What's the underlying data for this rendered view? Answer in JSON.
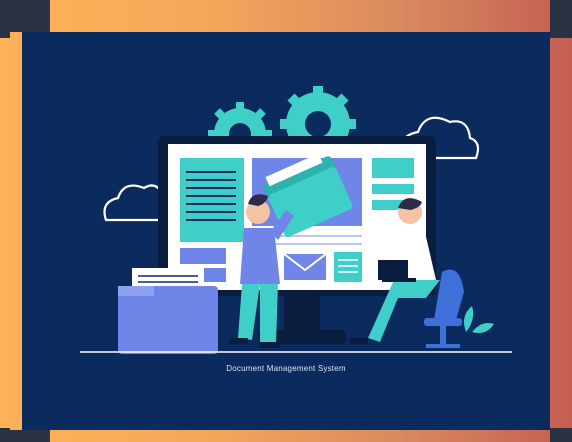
{
  "caption": "Document Management System",
  "colors": {
    "panel": "#0b2a5e",
    "teal": "#3fcfc8",
    "accent_blue": "#6f86e8",
    "frame_orange": "#ffb257"
  },
  "illustration": {
    "subject": "two people working with documents on a large monitor",
    "icons": [
      "gear-icon",
      "cloud-icon",
      "folder-icon",
      "envelope-icon",
      "laptop-icon",
      "chair-icon"
    ]
  }
}
